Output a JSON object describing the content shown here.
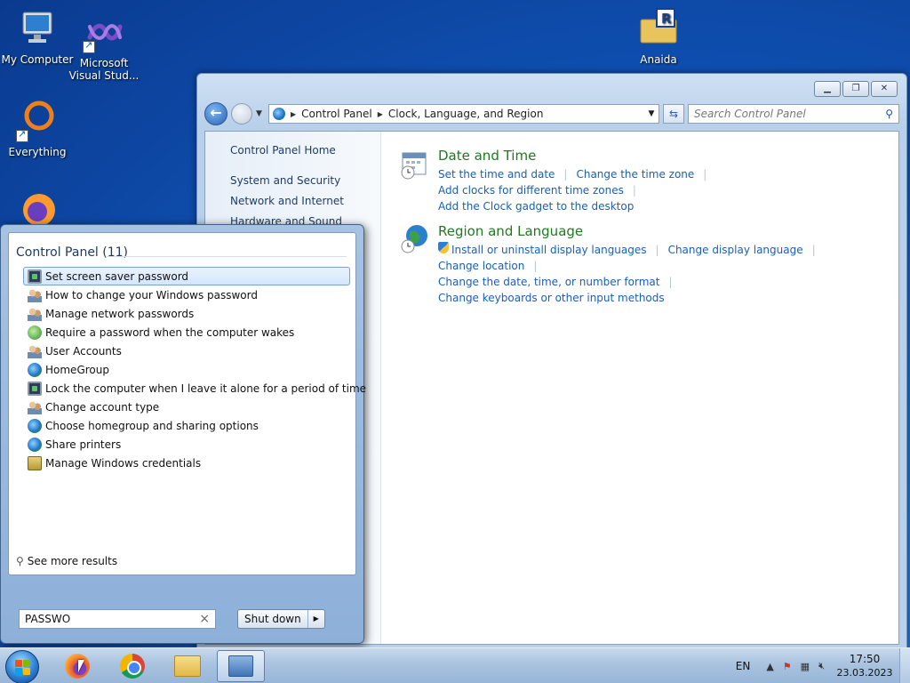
{
  "desktop": {
    "icons": [
      {
        "label": "My Computer"
      },
      {
        "label": "Microsoft Visual Stud..."
      },
      {
        "label": "Everything"
      },
      {
        "label": "Anaida"
      }
    ]
  },
  "control_panel": {
    "breadcrumb": [
      "Control Panel",
      "Clock, Language, and Region"
    ],
    "search_placeholder": "Search Control Panel",
    "sidebar": {
      "home": "Control Panel Home",
      "items": [
        "System and Security",
        "Network and Internet",
        "Hardware and Sound"
      ]
    },
    "categories": [
      {
        "title": "Date and Time",
        "links": [
          "Set the time and date",
          "Change the time zone",
          "Add clocks for different time zones",
          "Add the Clock gadget to the desktop"
        ]
      },
      {
        "title": "Region and Language",
        "links": [
          "Install or uninstall display languages",
          "Change display language",
          "Change location",
          "Change the date, time, or number format",
          "Change keyboards or other input methods"
        ]
      }
    ]
  },
  "start_menu": {
    "header": "Control Panel (11)",
    "results": [
      {
        "label": "Set screen saver password",
        "icon": "monitor-icon"
      },
      {
        "label": "How to change your Windows password",
        "icon": "users-icon"
      },
      {
        "label": "Manage network passwords",
        "icon": "users-icon"
      },
      {
        "label": "Require a password when the computer wakes",
        "icon": "power-options-icon"
      },
      {
        "label": "User Accounts",
        "icon": "users-icon"
      },
      {
        "label": "HomeGroup",
        "icon": "homegroup-icon"
      },
      {
        "label": "Lock the computer when I leave it alone for a period of time",
        "icon": "monitor-icon"
      },
      {
        "label": "Change account type",
        "icon": "users-icon"
      },
      {
        "label": "Choose homegroup and sharing options",
        "icon": "homegroup-icon"
      },
      {
        "label": "Share printers",
        "icon": "homegroup-icon"
      },
      {
        "label": "Manage Windows credentials",
        "icon": "credential-vault-icon"
      }
    ],
    "see_more": "See more results",
    "search_value": "PASSWO",
    "shutdown_label": "Shut down"
  },
  "taskbar": {
    "language": "EN",
    "time": "17:50",
    "date": "23.03.2023"
  }
}
